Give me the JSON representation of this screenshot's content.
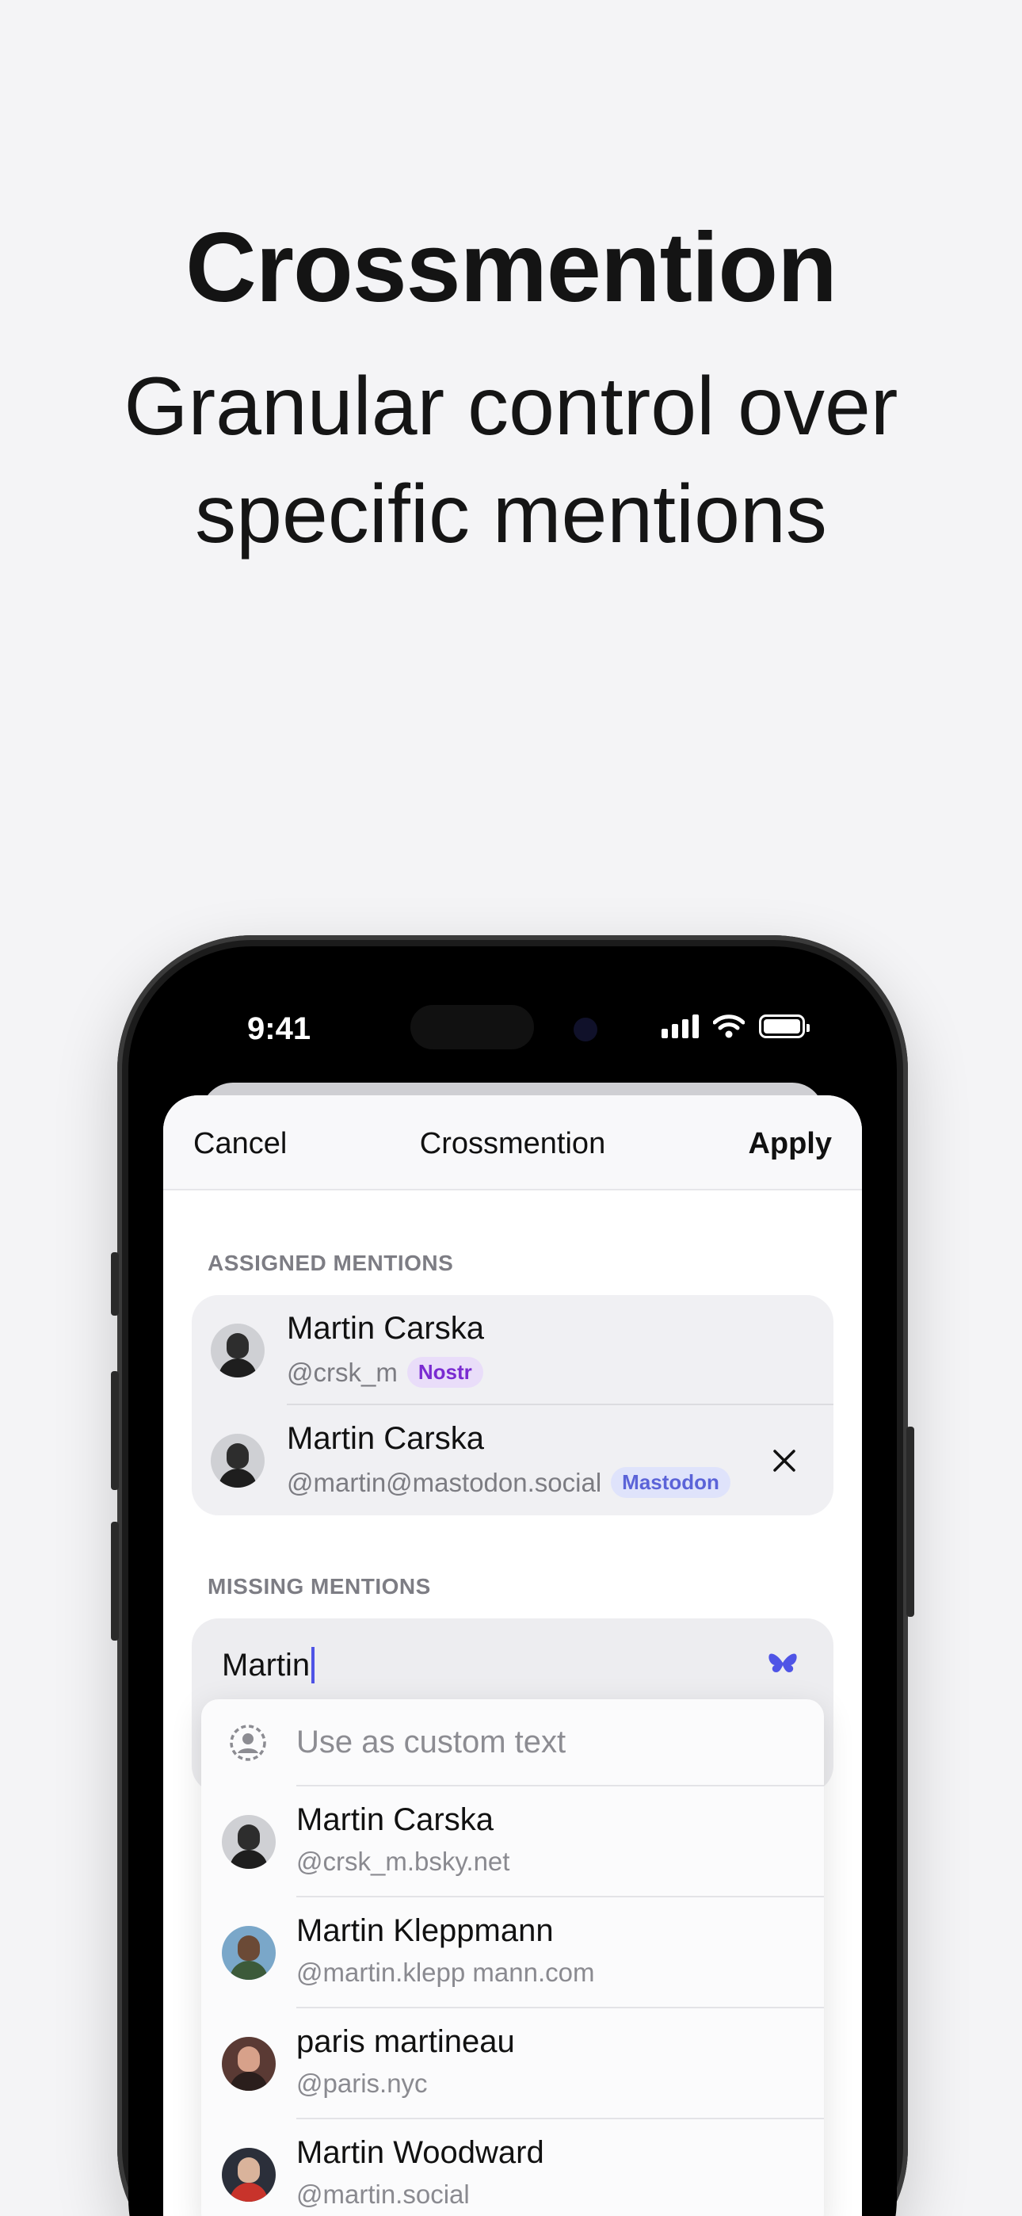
{
  "hero": {
    "title": "Crossmention",
    "subtitle_line1": "Granular control over",
    "subtitle_line2": "specific mentions"
  },
  "status_bar": {
    "time": "9:41"
  },
  "nav": {
    "cancel": "Cancel",
    "title": "Crossmention",
    "apply": "Apply"
  },
  "assigned": {
    "label": "ASSIGNED MENTIONS",
    "items": [
      {
        "name": "Martin Carska",
        "handle": "@crsk_m",
        "badge": "Nostr"
      },
      {
        "name": "Martin Carska",
        "handle": "@martin@mastodon.social",
        "badge": "Mastodon"
      }
    ]
  },
  "missing": {
    "label": "MISSING MENTIONS",
    "search_value": "Martin"
  },
  "suggestions": {
    "custom_text": "Use as custom text",
    "items": [
      {
        "name": "Martin Carska",
        "handle": "@crsk_m.bsky.net"
      },
      {
        "name": "Martin Kleppmann",
        "handle": "@martin.klepp mann.com"
      },
      {
        "name": "paris martineau",
        "handle": "@paris.nyc"
      },
      {
        "name": "Martin Woodward",
        "handle": "@martin.social"
      }
    ]
  },
  "colors": {
    "accent": "#4f54e6",
    "nostr_badge": "#7a2bd1",
    "mastodon_badge": "#5b63d8"
  },
  "icons": [
    "cellular-signal-icon",
    "wifi-icon",
    "battery-icon",
    "close-icon",
    "bluesky-butterfly-icon",
    "person-circle-icon"
  ]
}
